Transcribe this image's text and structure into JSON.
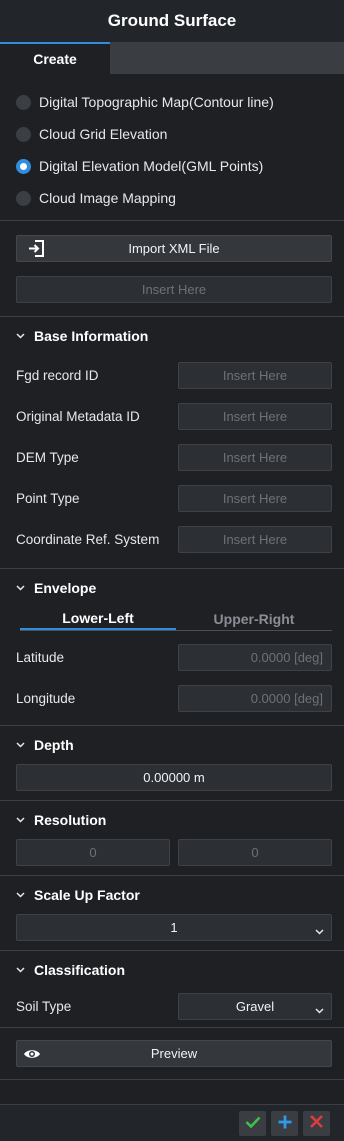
{
  "title": "Ground Surface",
  "tabs": {
    "create": "Create"
  },
  "source_options": [
    {
      "label": "Digital Topographic Map(Contour line)",
      "selected": false
    },
    {
      "label": "Cloud Grid Elevation",
      "selected": false
    },
    {
      "label": "Digital Elevation Model(GML Points)",
      "selected": true
    },
    {
      "label": "Cloud Image Mapping",
      "selected": false
    }
  ],
  "import": {
    "button_label": "Import XML File",
    "file_placeholder": "Insert Here"
  },
  "base_info": {
    "header": "Base Information",
    "fields": [
      {
        "label": "Fgd record ID",
        "placeholder": "Insert Here"
      },
      {
        "label": "Original Metadata ID",
        "placeholder": "Insert Here"
      },
      {
        "label": "DEM Type",
        "placeholder": "Insert Here"
      },
      {
        "label": "Point Type",
        "placeholder": "Insert Here"
      },
      {
        "label": "Coordinate Ref. System",
        "placeholder": "Insert Here"
      }
    ]
  },
  "envelope": {
    "header": "Envelope",
    "tabs": [
      "Lower-Left",
      "Upper-Right"
    ],
    "active_tab": "Lower-Left",
    "latitude_label": "Latitude",
    "latitude_value": "0.0000 [deg]",
    "longitude_label": "Longitude",
    "longitude_value": "0.0000 [deg]"
  },
  "depth": {
    "header": "Depth",
    "value": "0.00000 m"
  },
  "resolution": {
    "header": "Resolution",
    "x": "0",
    "y": "0"
  },
  "scale_up": {
    "header": "Scale Up Factor",
    "value": "1"
  },
  "classification": {
    "header": "Classification",
    "soil_label": "Soil Type",
    "soil_value": "Gravel"
  },
  "preview": {
    "label": "Preview"
  },
  "colors": {
    "accent": "#2f8ee0",
    "confirm": "#3fbf4a",
    "add": "#2f9be8",
    "cancel": "#e03c3c"
  },
  "icons": {
    "import": "import-icon",
    "eye": "eye-icon",
    "chevron": "chevron-down-icon",
    "confirm": "check-icon",
    "add": "plus-icon",
    "cancel": "close-icon"
  }
}
